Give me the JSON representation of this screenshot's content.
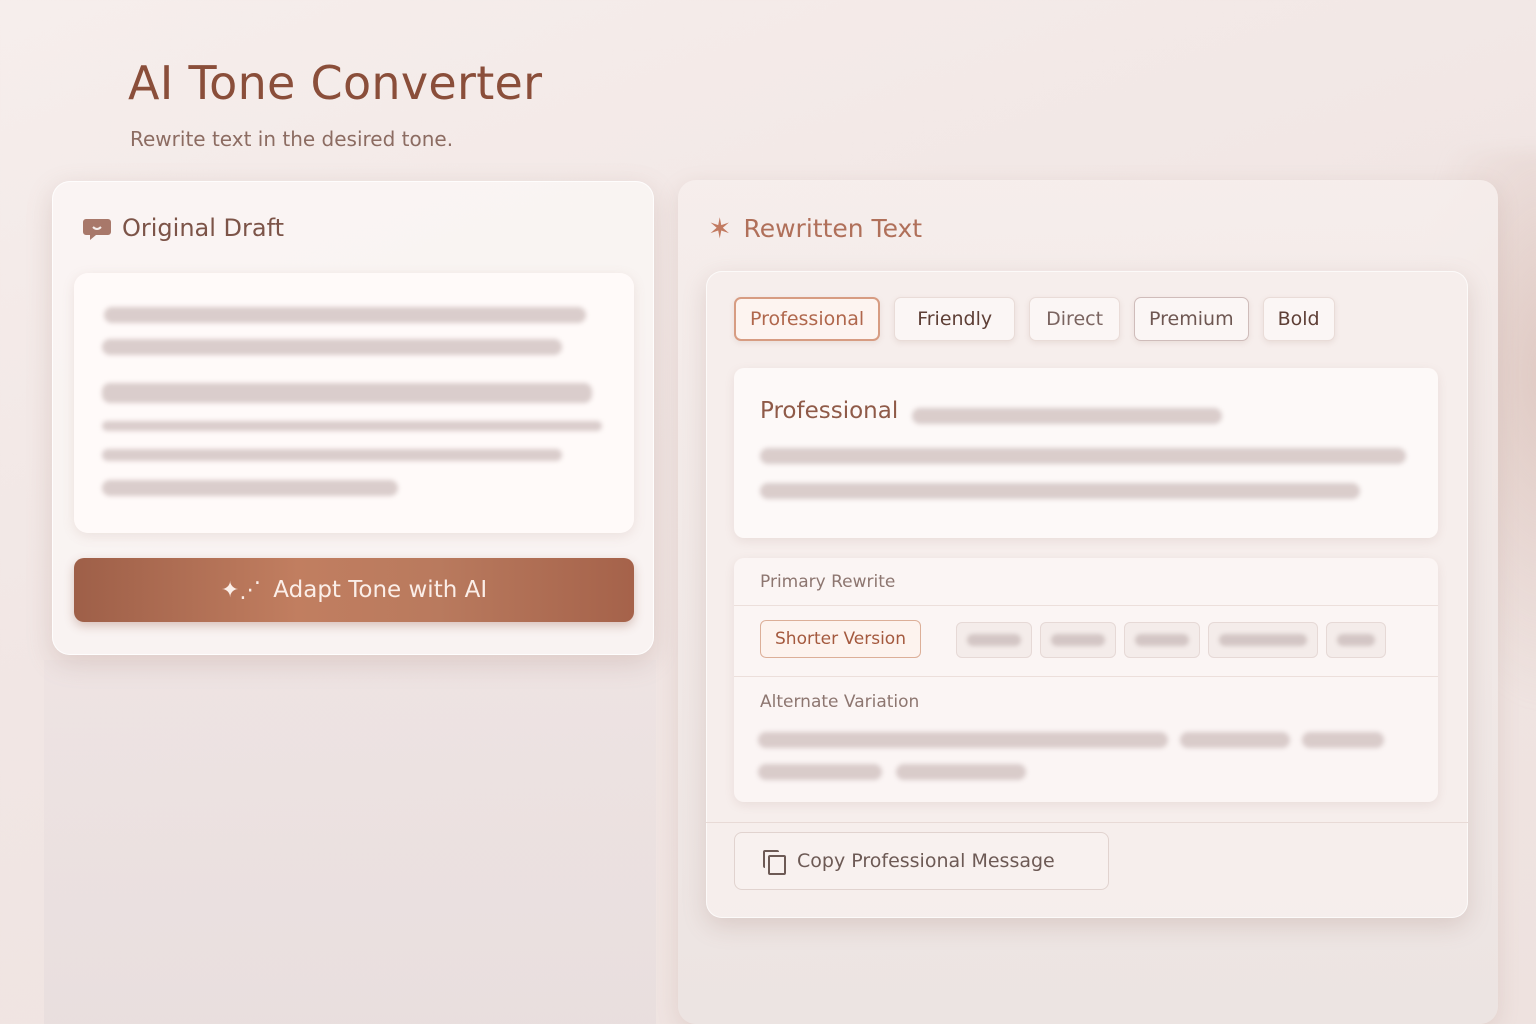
{
  "header": {
    "title": "AI Tone Converter",
    "subtitle": "Rewrite text in the desired tone."
  },
  "original": {
    "heading": "Original Draft",
    "icon": "chat-bubble-icon",
    "button_label": "Adapt Tone with AI",
    "button_icon": "sparkle-icon"
  },
  "rewritten": {
    "heading": "Rewritten Text",
    "icon": "star-icon",
    "tones": [
      "Professional",
      "Friendly",
      "Direct",
      "Premium",
      "Bold"
    ],
    "selected_tone": "Professional",
    "preview_label": "Professional",
    "primary_label": "Primary Rewrite",
    "shorter_label": "Shorter Version",
    "alternate_label": "Alternate Variation",
    "copy_label": "Copy Professional Message",
    "copy_icon": "copy-icon"
  },
  "colors": {
    "accent": "#b0674c",
    "button_gradient_start": "#9e5f48",
    "button_gradient_end": "#c17e60",
    "background": "#f3e9e7"
  }
}
